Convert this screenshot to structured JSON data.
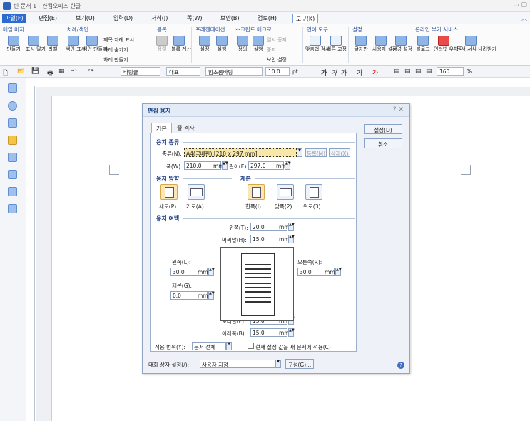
{
  "window": {
    "title": "빈 문서 1 - 한컴오피스 한글"
  },
  "menu": [
    "파일(F)",
    "편집(E)",
    "보기(U)",
    "입력(D)",
    "서식(J)",
    "쪽(W)",
    "보안(B)",
    "검토(H)",
    "도구(K)"
  ],
  "ribbon": {
    "groups": [
      {
        "title": "메일 머지",
        "buttons": [
          "만들기",
          "표시 달기",
          "라벨"
        ]
      },
      {
        "title": "차례/색인",
        "buttons": [
          "색인 표시",
          "색인 만들기"
        ],
        "small": [
          "제목 차례 표시",
          "차례 숨기기",
          "차례 만들기"
        ]
      },
      {
        "title": "블록",
        "buttons": [
          "정렬",
          "블록 계산"
        ]
      },
      {
        "title": "프레젠테이션",
        "buttons": [
          "설정",
          "실행"
        ]
      },
      {
        "title": "스크립트 매크로",
        "buttons": [
          "정의",
          "실행"
        ],
        "small": [
          "일시 중지",
          "중지",
          "보안 설정"
        ]
      },
      {
        "title": "언어 도구",
        "buttons": [
          "맞춤법 검사",
          "빠른 교정"
        ]
      },
      {
        "title": "설정",
        "buttons": [
          "글자판",
          "사용자 설정",
          "환경 설정"
        ]
      },
      {
        "title": "온라인 부가 서비스",
        "buttons": [
          "블로그",
          "인터넷 우체국",
          "문서 서식 내려받기"
        ]
      }
    ]
  },
  "format": {
    "style": "바탕글",
    "para": "대표",
    "font": "함초롬바탕",
    "size": "10.0",
    "unit": "pt",
    "zoom": "160",
    "zoom_unit": "%",
    "bold": "가",
    "italic": "가",
    "underline": "가",
    "fontcolor": "가",
    "strike": "가"
  },
  "dialog": {
    "title": "편집 용지",
    "tabs": [
      "기본",
      "줄 격자"
    ],
    "buttons": {
      "ok": "설정(D)",
      "cancel": "취소",
      "register": "등록(M)",
      "delete": "삭제(X)",
      "config": "구성(G)..."
    },
    "paper_type_label": "용지 종류",
    "type_label": "종류(N):",
    "type_value": "A4(국배판) [210 x 297 mm]",
    "width_label": "폭(W):",
    "width_value": "210.0",
    "width_unit": "mm",
    "height_label": "길이(E):",
    "height_value": "297.0",
    "height_unit": "mm",
    "orient_label": "용지 방향",
    "portrait": "세로(P)",
    "landscape": "가로(A)",
    "bind_label": "제본",
    "bind_single": "한쪽(I)",
    "bind_double": "맞쪽(2)",
    "bind_top": "위로(3)",
    "margin_label": "용지 여백",
    "top_label": "위쪽(T):",
    "top_value": "20.0",
    "header_label": "머리말(H):",
    "header_value": "15.0",
    "left_label": "왼쪽(L):",
    "left_value": "30.0",
    "right_label": "오른쪽(R):",
    "right_value": "30.0",
    "gutter_label": "제본(G):",
    "gutter_value": "0.0",
    "footer_label": "꼬리말(F):",
    "footer_value": "15.0",
    "bottom_label": "아래쪽(B):",
    "bottom_value": "15.0",
    "unit": "mm",
    "apply_label": "적용 범위(Y):",
    "apply_value": "문서 전체",
    "apply_new_label": "현재 설정 값을 새 문서에 적용(C)",
    "dialog_setting_label": "대화 상자 설정(/):",
    "dialog_setting_value": "사용자 지정",
    "help": "?"
  }
}
